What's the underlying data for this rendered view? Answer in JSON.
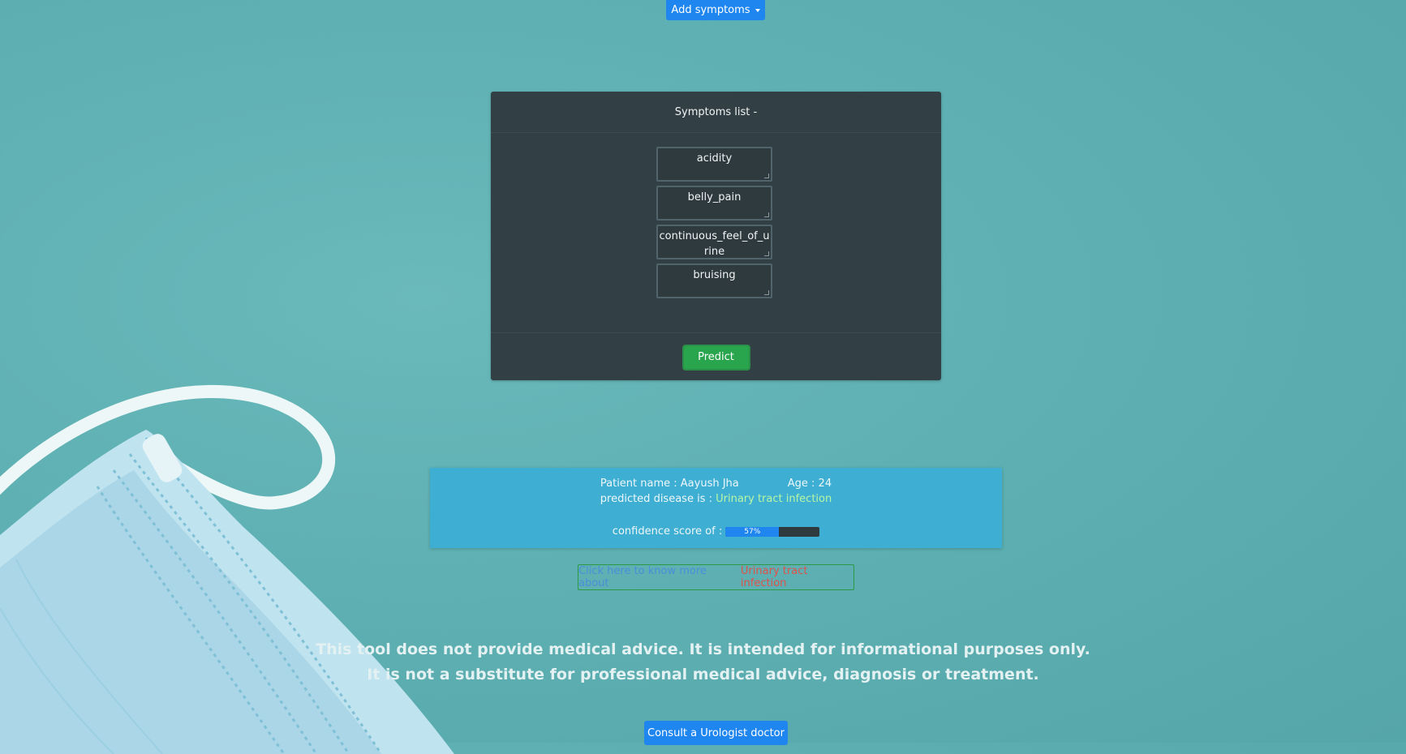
{
  "header": {
    "add_symptoms_label": "Add symptoms",
    "caret_icon": "caret-down-icon"
  },
  "symptoms_card": {
    "title": "Symptoms list -",
    "symptoms": [
      "acidity",
      "belly_pain",
      "continuous_feel_of_urine",
      "bruising"
    ],
    "predict_label": "Predict"
  },
  "result": {
    "patient_label": "Patient name : Aayush Jha",
    "age_label": "Age : 24",
    "predicted_prefix": "predicted disease is : ",
    "disease": "Urinary tract infection",
    "confidence_label": "confidence score of :",
    "confidence_percent": 57,
    "confidence_text": "57%"
  },
  "know_more": {
    "link_text": "Click here to know more about",
    "disease": "Urinary tract infection"
  },
  "disclaimer": {
    "line1": "This tool does not provide medical advice. It is intended for informational purposes only.",
    "line2": "It is not a substitute for professional medical advice, diagnosis or treatment."
  },
  "consult": {
    "label": "Consult a Urologist doctor"
  },
  "colors": {
    "primary": "#1f86f0",
    "success": "#28a54d",
    "info": "#3eaed3",
    "dark": "#323f44",
    "background": "#5eb0b2"
  },
  "decoration": {
    "image": "surgical-mask-image"
  }
}
